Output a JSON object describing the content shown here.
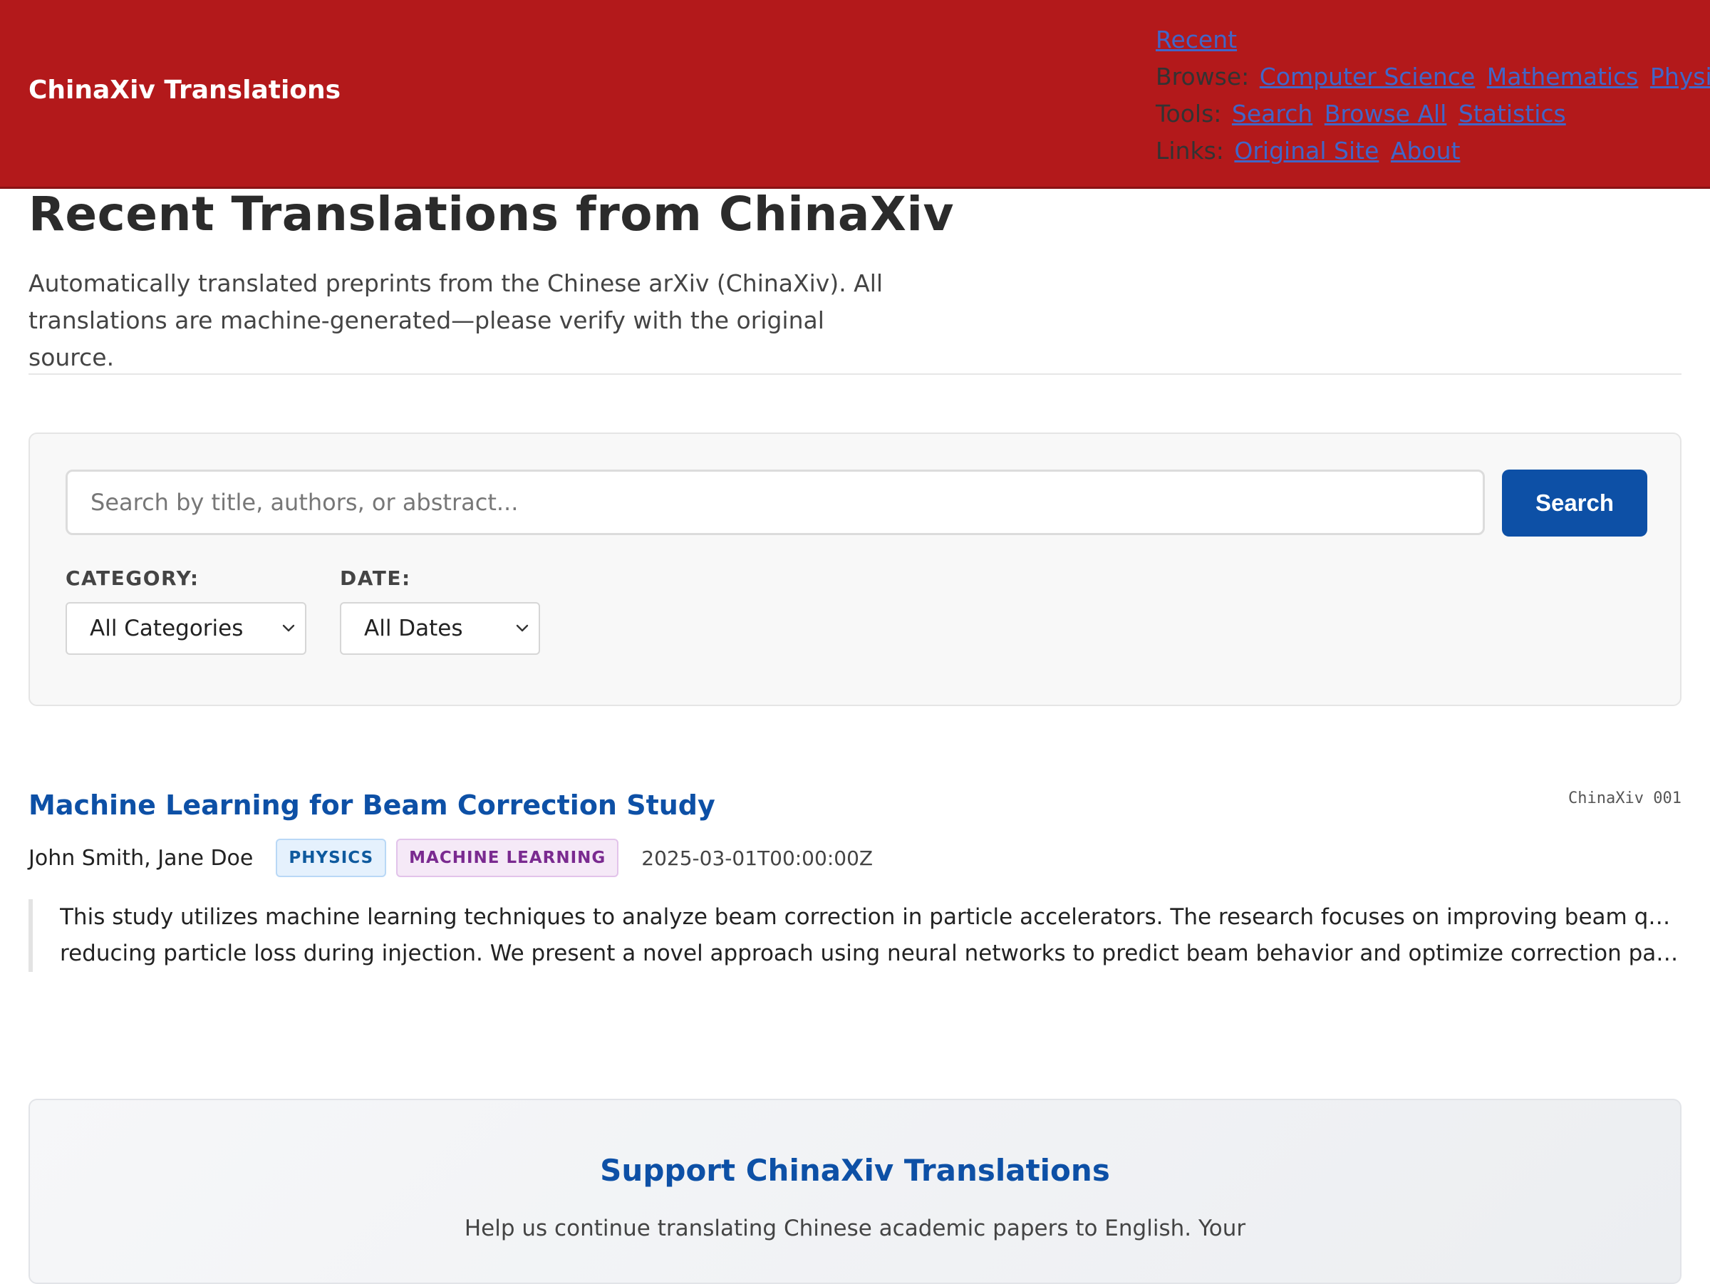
{
  "header": {
    "brand": "ChinaXiv Translations",
    "nav": {
      "recent": "Recent",
      "browse_label": "Browse:",
      "browse_links": [
        "Computer Science",
        "Mathematics",
        "Physics"
      ],
      "tools_label": "Tools:",
      "tools_links": [
        "Search",
        "Browse All",
        "Statistics"
      ],
      "links_label": "Links:",
      "links_links": [
        "Original Site",
        "About"
      ]
    }
  },
  "intro": {
    "title": "Recent Translations from ChinaXiv",
    "description": "Automatically translated preprints from the Chinese arXiv (ChinaXiv). All translations are machine-generated—please verify with the original source."
  },
  "search": {
    "placeholder": "Search by title, authors, or abstract...",
    "button_label": "Search",
    "category_label": "CATEGORY:",
    "category_value": "All Categories",
    "date_label": "DATE:",
    "date_value": "All Dates"
  },
  "papers": [
    {
      "title": "Machine Learning for Beam Correction Study",
      "id": "ChinaXiv 001",
      "authors": "John Smith, Jane Doe",
      "tags": [
        "PHYSICS",
        "MACHINE LEARNING"
      ],
      "date": "2025-03-01T00:00:00Z",
      "abstract_lines": [
        "This study utilizes machine learning techniques to analyze beam correction in particle accelerators. The research focuses on improving beam quality and",
        "reducing particle loss during injection. We present a novel approach using neural networks to predict beam behavior and optimize correction paramete..."
      ]
    }
  ],
  "support": {
    "title": "Support ChinaXiv Translations",
    "text": "Help us continue translating Chinese academic papers to English. Your"
  },
  "colors": {
    "header_bg": "#b3191b",
    "accent_blue": "#0d50a6",
    "link_blue": "#4166c8"
  }
}
